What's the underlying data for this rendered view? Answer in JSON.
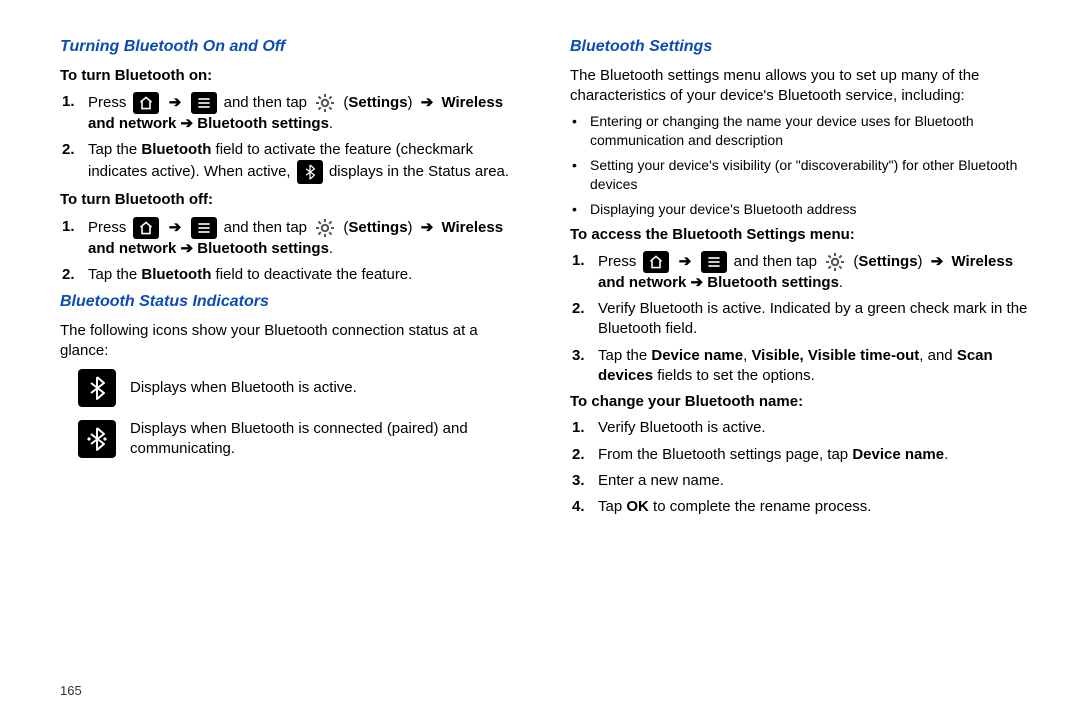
{
  "left": {
    "h_turning": "Turning Bluetooth On and Off",
    "sub_on": "To turn Bluetooth on:",
    "on_step1_a": "Press ",
    "on_step1_b": " and then tap ",
    "on_step1_c": " (",
    "on_step1_d": ") ",
    "settings_label": "Settings",
    "nav_path1": "Wireless and network  ➔  Bluetooth settings",
    "on_step2_a": "Tap the ",
    "on_step2_bold1": "Bluetooth",
    "on_step2_b": " field to activate the feature (checkmark indicates active). When active, ",
    "on_step2_c": " displays in the Status area.",
    "sub_off": "To turn Bluetooth off:",
    "off_step1_a": "Press ",
    "off_step1_b": " and then tap ",
    "off_step1_c": " (",
    "off_step1_d": ") ",
    "nav_path2": "Wireless and network ➔ Bluetooth settings",
    "off_step2_a": "Tap the ",
    "off_step2_bold1": "Bluetooth",
    "off_step2_b": " field to deactivate the feature.",
    "h_indicators": "Bluetooth Status Indicators",
    "indicators_intro": "The following icons show your Bluetooth connection status at a glance:",
    "ind1": "Displays when Bluetooth is active.",
    "ind2": "Displays when Bluetooth is connected (paired) and communicating."
  },
  "right": {
    "h_settings": "Bluetooth Settings",
    "settings_intro": "The Bluetooth settings menu allows you to set up many of the characteristics of your device's Bluetooth service, including:",
    "bullet1": "Entering or changing the name your device uses for Bluetooth communication and description",
    "bullet2": "Setting your device's visibility (or \"discoverability\") for other Bluetooth devices",
    "bullet3": "Displaying your device's Bluetooth address",
    "sub_access": "To access the Bluetooth Settings menu:",
    "acc_step1_a": "Press ",
    "acc_step1_b": " and then tap ",
    "acc_step1_c": " (",
    "acc_step1_d": ") ",
    "settings_label": "Settings",
    "nav_path3": "Wireless and network ➔ Bluetooth settings",
    "acc_step2": "Verify Bluetooth is active. Indicated by a green check mark in the Bluetooth field.",
    "acc_step3_a": "Tap the ",
    "acc_step3_bold1": "Device name",
    "acc_step3_b": ", ",
    "acc_step3_bold2": "Visible, Visible time-out",
    "acc_step3_c": ", and ",
    "acc_step3_bold3": "Scan devices",
    "acc_step3_d": " fields to set the options.",
    "sub_change": "To change your Bluetooth name:",
    "chg_step1": "Verify Bluetooth is active.",
    "chg_step2_a": "From the Bluetooth settings page, tap ",
    "chg_step2_bold": "Device name",
    "chg_step2_b": ".",
    "chg_step3": "Enter a new name.",
    "chg_step4_a": "Tap ",
    "chg_step4_bold": "OK",
    "chg_step4_b": " to complete the rename process."
  },
  "page_number": "165"
}
